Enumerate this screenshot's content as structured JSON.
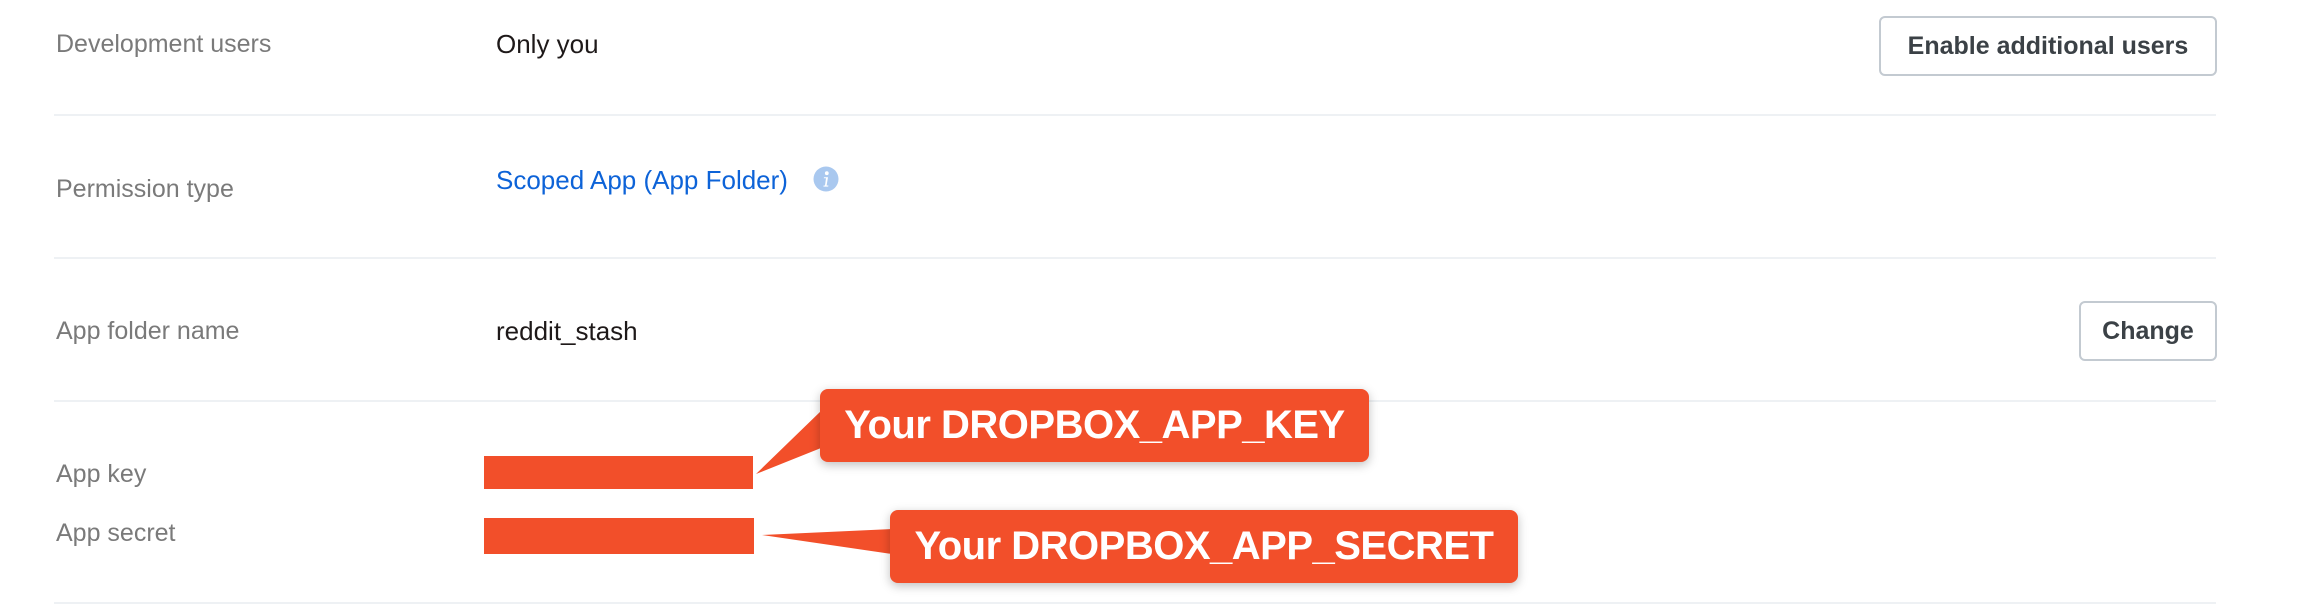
{
  "rows": {
    "development_users": {
      "label": "Development users",
      "value": "Only you",
      "button_label": "Enable additional users"
    },
    "permission_type": {
      "label": "Permission type",
      "value": "Scoped App (App Folder)",
      "info_icon": "info-icon"
    },
    "app_folder_name": {
      "label": "App folder name",
      "value": "reddit_stash",
      "button_label": "Change"
    },
    "app_key": {
      "label": "App key"
    },
    "app_secret": {
      "label": "App secret"
    }
  },
  "annotations": {
    "app_key_callout": "Your DROPBOX_APP_KEY",
    "app_secret_callout": "Your DROPBOX_APP_SECRET"
  },
  "colors": {
    "accent_link": "#0d63d8",
    "annotation": "#f24f2a",
    "label_text": "#7a7a7a",
    "info_icon": "#a9c8ef"
  }
}
